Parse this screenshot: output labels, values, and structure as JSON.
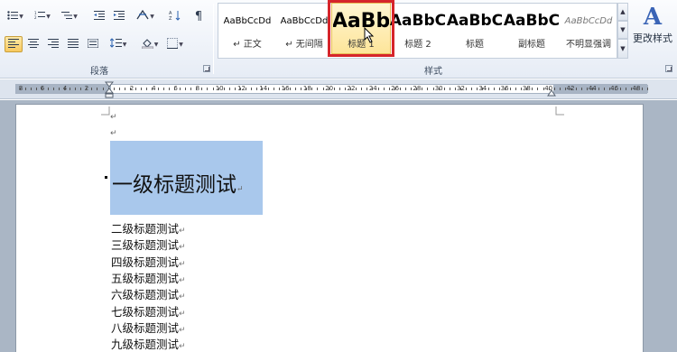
{
  "ribbon": {
    "groups": {
      "paragraph_label": "段落",
      "styles_label": "样式"
    },
    "style_gallery": [
      {
        "preview": "AaBbCcDd",
        "name": "↵ 正文",
        "preview_size": 10,
        "bold": false,
        "italic": false
      },
      {
        "preview": "AaBbCcDd",
        "name": "↵ 无间隔",
        "preview_size": 10,
        "bold": false,
        "italic": false
      },
      {
        "preview": "AaBb",
        "name": "标题 1",
        "preview_size": 22,
        "bold": true,
        "italic": false
      },
      {
        "preview": "AaBbC",
        "name": "标题 2",
        "preview_size": 17,
        "bold": true,
        "italic": false
      },
      {
        "preview": "AaBbC",
        "name": "标题",
        "preview_size": 17,
        "bold": true,
        "italic": false
      },
      {
        "preview": "AaBbC",
        "name": "副标题",
        "preview_size": 17,
        "bold": true,
        "italic": false
      },
      {
        "preview": "AaBbCcDd",
        "name": "不明显强调",
        "preview_size": 10,
        "bold": false,
        "italic": true
      }
    ],
    "selected_style_index": 2,
    "change_styles": {
      "icon": "A",
      "label": "更改样式"
    }
  },
  "ruler": {
    "left_numbers": [
      "8",
      "6",
      "4",
      "2",
      "2"
    ],
    "right_numbers": [
      "2",
      "4",
      "6",
      "8",
      "10",
      "12",
      "14",
      "16",
      "18",
      "20",
      "22",
      "24",
      "26",
      "28",
      "30",
      "32",
      "34",
      "36",
      "38",
      "40",
      "42",
      "44",
      "46",
      "48"
    ]
  },
  "document": {
    "empty_paragraph_mark": "↵",
    "heading1": "一级标题测试",
    "lines": [
      "二级标题测试",
      "三级标题测试",
      "四级标题测试",
      "五级标题测试",
      "六级标题测试",
      "七级标题测试",
      "八级标题测试",
      "九级标题测试"
    ],
    "selection_color": "#a9c8ec"
  },
  "colors": {
    "highlight_box": "#d6252b",
    "ribbon_bg": "#e6ecf5",
    "doc_bg": "#aab6c5"
  }
}
